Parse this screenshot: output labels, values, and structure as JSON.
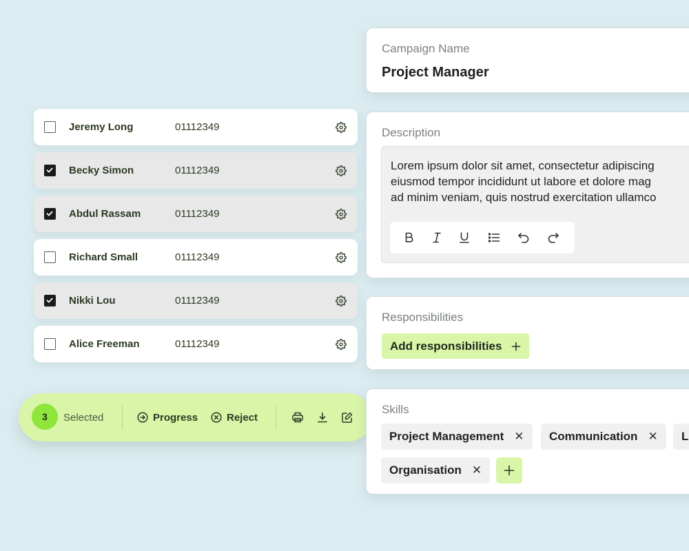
{
  "candidates": [
    {
      "name": "Jeremy Long",
      "phone": "01112349",
      "checked": false
    },
    {
      "name": "Becky Simon",
      "phone": "01112349",
      "checked": true
    },
    {
      "name": "Abdul Rassam",
      "phone": "01112349",
      "checked": true
    },
    {
      "name": "Richard Small",
      "phone": "01112349",
      "checked": false
    },
    {
      "name": "Nikki Lou",
      "phone": "01112349",
      "checked": true
    },
    {
      "name": "Alice Freeman",
      "phone": "01112349",
      "checked": false
    }
  ],
  "action_bar": {
    "count": "3",
    "selected_label": "Selected",
    "progress_label": "Progress",
    "reject_label": "Reject",
    "icons": [
      "print-icon",
      "download-icon",
      "edit-icon"
    ]
  },
  "campaign": {
    "label": "Campaign Name",
    "value": "Project Manager"
  },
  "description": {
    "label": "Description",
    "lines": [
      "Lorem ipsum dolor sit amet, consectetur adipiscing",
      "eiusmod tempor incididunt ut labore et dolore mag",
      "ad minim veniam, quis nostrud exercitation ullamco"
    ],
    "toolbar_icons": [
      "bold-icon",
      "italic-icon",
      "underline-icon",
      "list-icon",
      "undo-icon",
      "redo-icon"
    ]
  },
  "responsibilities": {
    "label": "Responsibilities",
    "add_label": "Add responsibilities"
  },
  "skills": {
    "label": "Skills",
    "chips": [
      "Project Management",
      "Communication",
      "Le",
      "Organisation"
    ]
  },
  "colors": {
    "background": "#dcedf1",
    "accent_light": "#d9f5a8",
    "accent": "#8fe53c",
    "selected_row": "#e8e8e8"
  }
}
